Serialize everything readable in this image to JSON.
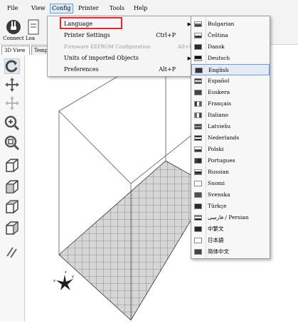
{
  "menubar": {
    "items": [
      "File",
      "View",
      "Config",
      "Printer",
      "Tools",
      "Help"
    ]
  },
  "toolbar": {
    "connect_label": "Connect",
    "load_label": "Loa"
  },
  "tabs": [
    "3D View",
    "Temp"
  ],
  "config_menu": {
    "items": [
      {
        "label": "Language",
        "shortcut": "",
        "submenu": true,
        "disabled": false
      },
      {
        "label": "Printer Settings",
        "shortcut": "Ctrl+P",
        "submenu": false,
        "disabled": false
      },
      {
        "label": "Firmware EEPROM Configuration",
        "shortcut": "Alt+E",
        "submenu": false,
        "disabled": true
      },
      {
        "label": "Units of imported Objects",
        "shortcut": "",
        "submenu": true,
        "disabled": false
      },
      {
        "label": "Preferences",
        "shortcut": "Alt+P",
        "submenu": false,
        "disabled": false
      }
    ]
  },
  "language_menu": {
    "selected": "English",
    "items": [
      {
        "label": "Bulgarian",
        "flag": "bg-flag-icon"
      },
      {
        "label": "Čeština",
        "flag": "cz-flag-icon"
      },
      {
        "label": "Dansk",
        "flag": "dk-flag-icon"
      },
      {
        "label": "Deutsch",
        "flag": "de-flag-icon"
      },
      {
        "label": "English",
        "flag": "gb-flag-icon"
      },
      {
        "label": "Español",
        "flag": "es-flag-icon"
      },
      {
        "label": "Euskera",
        "flag": "eus-flag-icon"
      },
      {
        "label": "Français",
        "flag": "fr-flag-icon"
      },
      {
        "label": "Italiano",
        "flag": "it-flag-icon"
      },
      {
        "label": "Latviešu",
        "flag": "lv-flag-icon"
      },
      {
        "label": "Nederlands",
        "flag": "nl-flag-icon"
      },
      {
        "label": "Polski",
        "flag": "pl-flag-icon"
      },
      {
        "label": "Portugues",
        "flag": "pt-flag-icon"
      },
      {
        "label": "Russian",
        "flag": "ru-flag-icon"
      },
      {
        "label": "Suomi",
        "flag": "fi-flag-icon"
      },
      {
        "label": "Svenska",
        "flag": "se-flag-icon"
      },
      {
        "label": "Türkçe",
        "flag": "tr-flag-icon"
      },
      {
        "label": "فارسی / Persian",
        "flag": "ir-flag-icon"
      },
      {
        "label": "中繁文",
        "flag": "tw-flag-icon"
      },
      {
        "label": "日本語",
        "flag": "jp-flag-icon"
      },
      {
        "label": "简体中文",
        "flag": "cn-flag-icon"
      }
    ]
  },
  "colors": {
    "highlight_box": "#e8262b",
    "selection": "#e4ebf4",
    "selection_border": "#6f9bd0"
  }
}
